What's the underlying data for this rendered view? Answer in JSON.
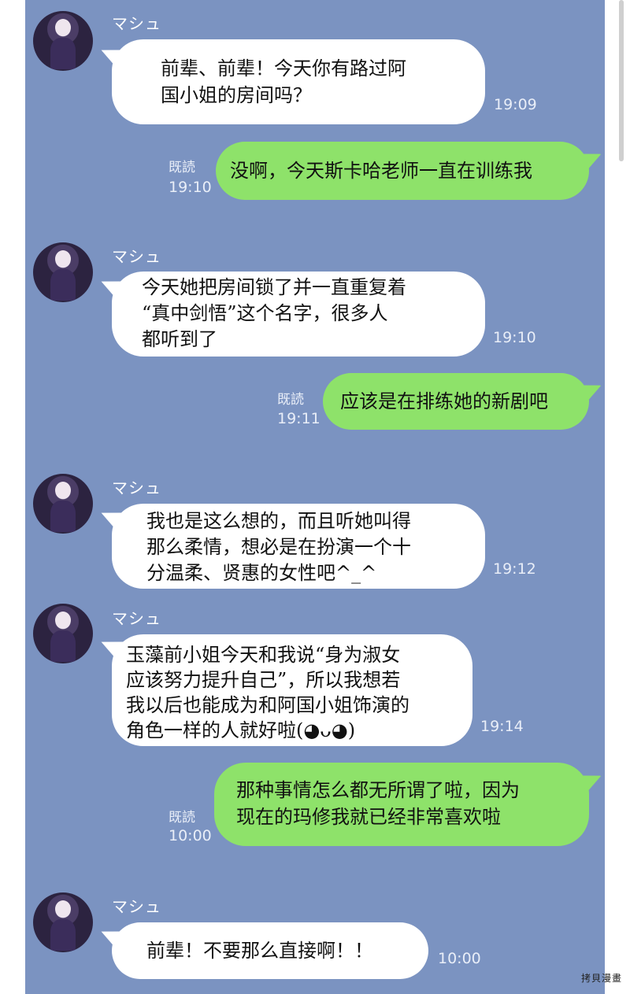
{
  "sender_name": "マシュ",
  "read_label": "既読",
  "watermark": "拷貝漫畫",
  "messages": [
    {
      "side": "left",
      "text": "前辈、前辈！今天你有路过阿\n国小姐的房间吗？",
      "time": "19:09"
    },
    {
      "side": "right",
      "text": "没啊，今天斯卡哈老师一直在训练我",
      "time": "19:10"
    },
    {
      "side": "left",
      "text": "今天她把房间锁了并一直重复着\n“真中剑悟”这个名字，很多人\n都听到了",
      "time": "19:10"
    },
    {
      "side": "right",
      "text": "应该是在排练她的新剧吧",
      "time": "19:11"
    },
    {
      "side": "left",
      "text": "我也是这么想的，而且听她叫得\n那么柔情，想必是在扮演一个十\n分温柔、贤惠的女性吧^_^",
      "time": "19:12"
    },
    {
      "side": "left",
      "text": "玉藻前小姐今天和我说“身为淑女\n应该努力提升自己”，所以我想若\n我以后也能成为和阿国小姐饰演的\n角色一样的人就好啦(◕ᴗ◕)",
      "time": "19:14"
    },
    {
      "side": "right",
      "text": "那种事情怎么都无所谓了啦，因为\n现在的玛修我就已经非常喜欢啦",
      "time": "10:00"
    },
    {
      "side": "left",
      "text": "前辈！不要那么直接啊！！",
      "time": "10:00"
    }
  ]
}
